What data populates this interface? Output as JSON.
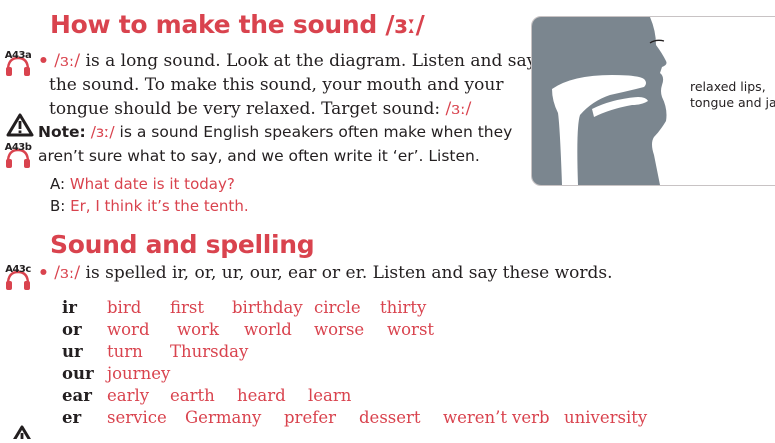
{
  "section1": {
    "title": "How to make the sound /ɜː/",
    "track_a": "A43a",
    "para1_sym": "/ɜː/",
    "para1_line1": " is a long sound. Look at the diagram. Listen and say",
    "para1_line2": "the sound. To make this sound, your mouth and your",
    "para1_line3a": "tongue should be very relaxed. Target sound: ",
    "para1_line3b": "/ɜː/",
    "track_b": "A43b",
    "note_label": "Note:",
    "note_sym": "/ɜː/",
    "note_line1": " is a sound English speakers often make when they",
    "note_line2": "aren’t sure what to say, and we often write it ‘er’. Listen.",
    "dialog": [
      {
        "speaker": "A:",
        "text": "What date is it today?"
      },
      {
        "speaker": "B:",
        "text": "Er, I think it’s the tenth."
      }
    ]
  },
  "diagram": {
    "caption_line1": "relaxed lips,",
    "caption_line2": "tongue and jaw",
    "colors": {
      "head": "#7b868f",
      "cavity": "#ffffff",
      "box_border": "#c8c3c4"
    }
  },
  "section2": {
    "title": "Sound and spelling",
    "track_c": "A43c",
    "intro_sym": "/ɜː/",
    "intro_text": " is spelled ir, or, ur, our, ear or er. Listen and say these words.",
    "rows": [
      {
        "label": "ir",
        "words": [
          "bird",
          "first",
          "birthday",
          "circle",
          "thirty"
        ]
      },
      {
        "label": "or",
        "words": [
          "word",
          "work",
          "world",
          "worse",
          "worst"
        ]
      },
      {
        "label": "ur",
        "words": [
          "turn",
          "Thursday"
        ]
      },
      {
        "label": "our",
        "words": [
          "journey"
        ]
      },
      {
        "label": "ear",
        "words": [
          "early",
          "earth",
          "heard",
          "learn"
        ]
      },
      {
        "label": "er",
        "words": [
          "service",
          "Germany",
          "prefer",
          "dessert",
          "weren’t",
          "verb",
          "university"
        ]
      }
    ]
  },
  "colors": {
    "accent_red": "#d9434e",
    "text": "#231f20",
    "headphone": "#d9434e"
  },
  "icons": [
    "headphones-icon",
    "warning-triangle-icon",
    "bullet-dot-icon"
  ]
}
